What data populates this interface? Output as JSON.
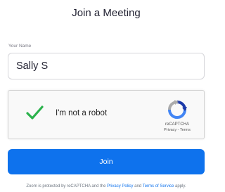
{
  "page": {
    "title": "Join a Meeting"
  },
  "name_field": {
    "label": "Your Name",
    "value": "Sally S"
  },
  "captcha": {
    "label": "I'm not a robot",
    "checked": true,
    "brand": "reCAPTCHA",
    "privacy_link": "Privacy",
    "separator": " - ",
    "terms_link": "Terms"
  },
  "join_button": {
    "label": "Join",
    "color": "#0e72ed"
  },
  "footer": {
    "prefix": "Zoom is protected by reCAPTCHA and the ",
    "privacy_policy": "Privacy Policy",
    "middle": " and ",
    "terms_of_service": "Terms of Service",
    "suffix": " apply."
  }
}
